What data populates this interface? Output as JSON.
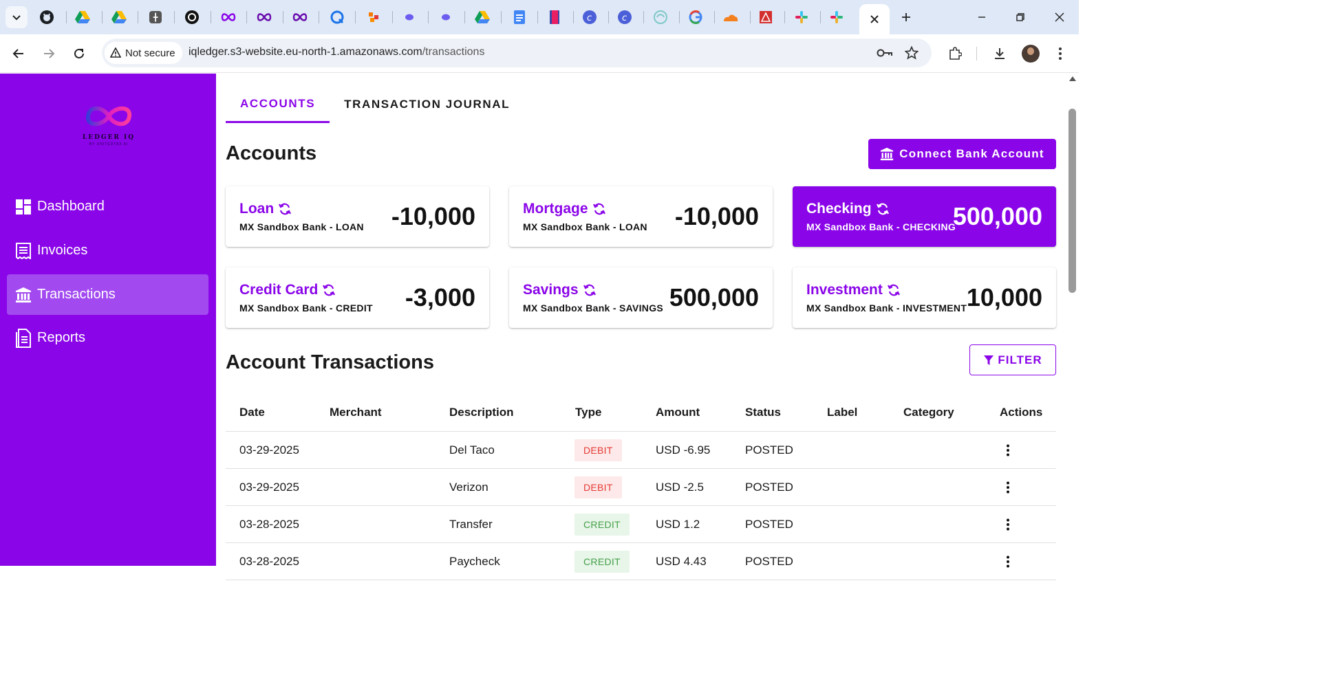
{
  "browser": {
    "security_label": "Not secure",
    "url_domain": "iqledger.s3-website.eu-north-1.amazonaws.com",
    "url_path": "/transactions"
  },
  "sidebar": {
    "logo_text": "LEDGER IQ",
    "logo_sub": "BY UNITEDTAX AI",
    "items": [
      {
        "label": "Dashboard",
        "icon": "dashboard-icon",
        "active": false
      },
      {
        "label": "Invoices",
        "icon": "receipt-icon",
        "active": false
      },
      {
        "label": "Transactions",
        "icon": "bank-icon",
        "active": true
      },
      {
        "label": "Reports",
        "icon": "document-icon",
        "active": false
      }
    ]
  },
  "main": {
    "tabs": [
      {
        "label": "ACCOUNTS",
        "active": true
      },
      {
        "label": "TRANSACTION JOURNAL",
        "active": false
      }
    ],
    "accounts_heading": "Accounts",
    "connect_button": "Connect Bank Account",
    "accounts": [
      {
        "name": "Loan",
        "sub": "MX Sandbox Bank - LOAN",
        "amount": "-10,000",
        "selected": false
      },
      {
        "name": "Mortgage",
        "sub": "MX Sandbox Bank - LOAN",
        "amount": "-10,000",
        "selected": false
      },
      {
        "name": "Checking",
        "sub": "MX Sandbox Bank - CHECKING",
        "amount": "500,000",
        "selected": true
      },
      {
        "name": "Credit Card",
        "sub": "MX Sandbox Bank - CREDIT",
        "amount": "-3,000",
        "selected": false
      },
      {
        "name": "Savings",
        "sub": "MX Sandbox Bank - SAVINGS",
        "amount": "500,000",
        "selected": false
      },
      {
        "name": "Investment",
        "sub": "MX Sandbox Bank - INVESTMENT",
        "amount": "10,000",
        "selected": false
      }
    ],
    "transactions_heading": "Account Transactions",
    "filter_button": "FILTER",
    "table": {
      "headers": [
        "Date",
        "Merchant",
        "Description",
        "Type",
        "Amount",
        "Status",
        "Label",
        "Category",
        "Actions"
      ],
      "rows": [
        {
          "date": "03-29-2025",
          "merchant": "",
          "description": "Del Taco",
          "type": "DEBIT",
          "amount": "USD -6.95",
          "status": "POSTED",
          "label": "",
          "category": ""
        },
        {
          "date": "03-29-2025",
          "merchant": "",
          "description": "Verizon",
          "type": "DEBIT",
          "amount": "USD -2.5",
          "status": "POSTED",
          "label": "",
          "category": ""
        },
        {
          "date": "03-28-2025",
          "merchant": "",
          "description": "Transfer",
          "type": "CREDIT",
          "amount": "USD 1.2",
          "status": "POSTED",
          "label": "",
          "category": ""
        },
        {
          "date": "03-28-2025",
          "merchant": "",
          "description": "Paycheck",
          "type": "CREDIT",
          "amount": "USD 4.43",
          "status": "POSTED",
          "label": "",
          "category": ""
        }
      ]
    }
  },
  "colors": {
    "brand": "#8a05e8",
    "brand_active": "#a24af0",
    "debit_bg": "#fde9e9",
    "debit_text": "#e53935",
    "credit_bg": "#e8f5e9",
    "credit_text": "#43a047"
  }
}
